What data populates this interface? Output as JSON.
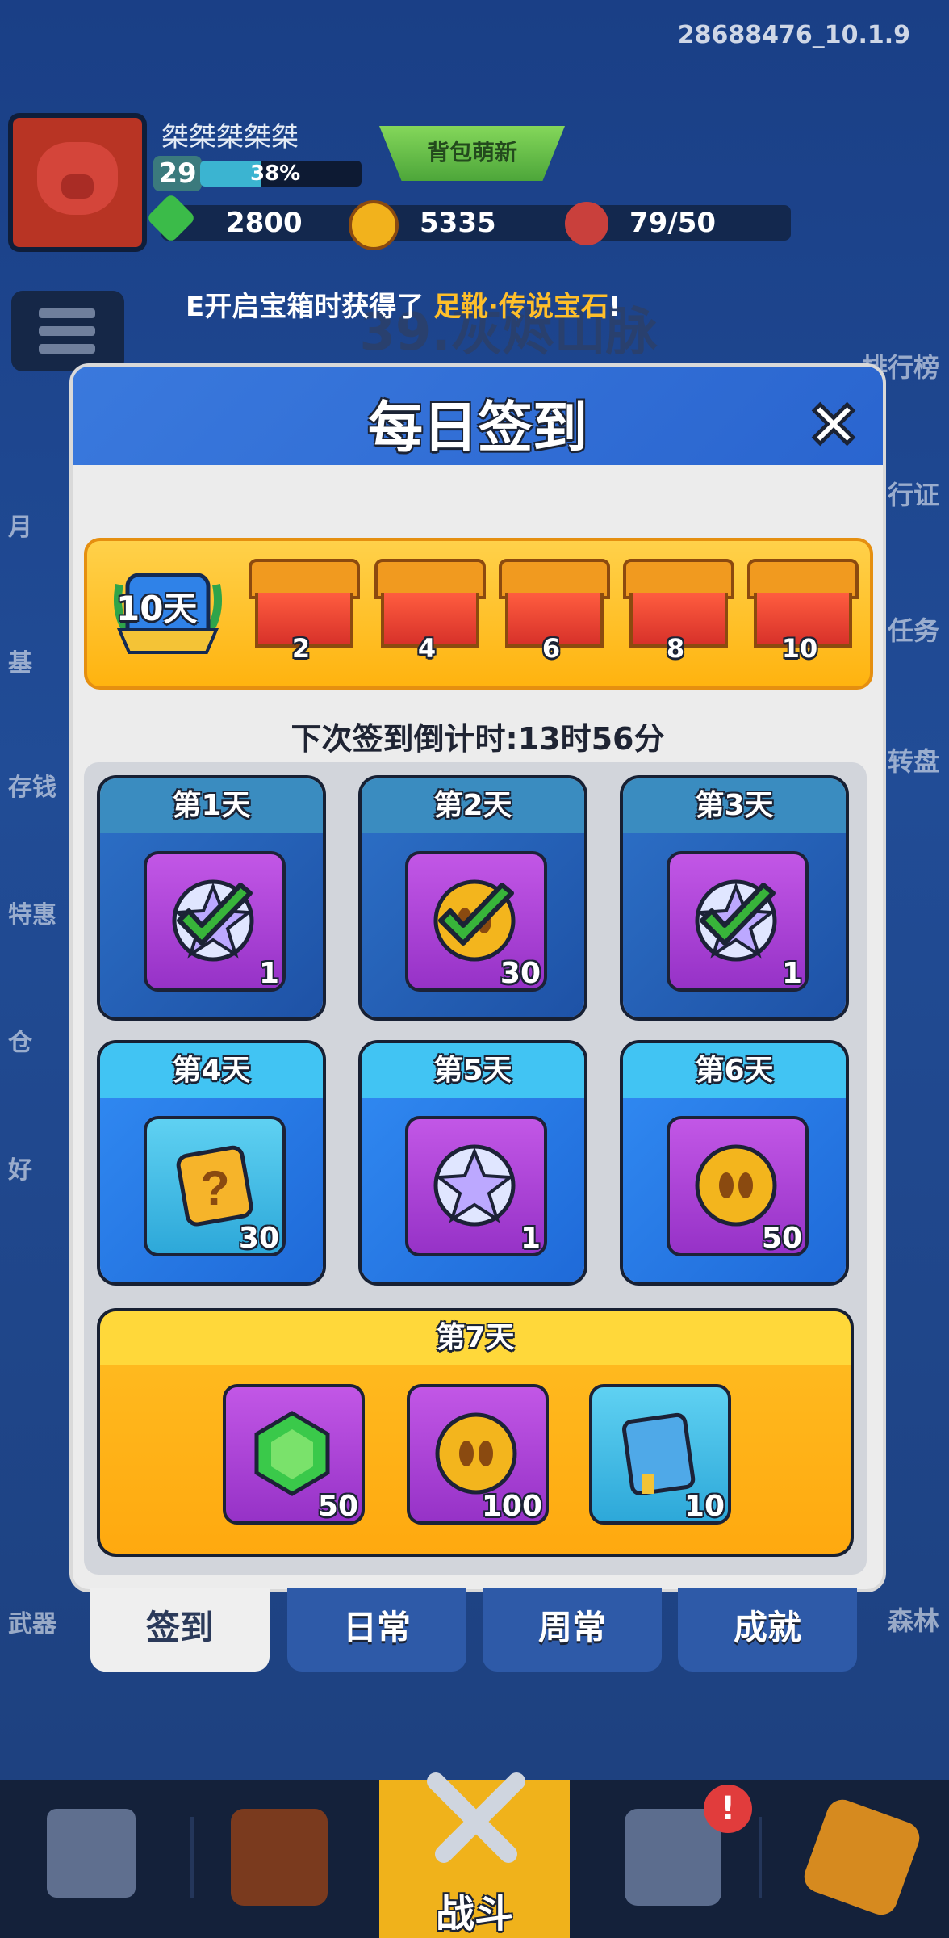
{
  "version": "28688476_10.1.9",
  "player": {
    "name": "桀桀桀桀桀",
    "level": "29",
    "xp_percent_label": "38%",
    "xp_fraction": 0.38
  },
  "resources": {
    "gems": "2800",
    "coins": "5335",
    "stamina": "79/50"
  },
  "news_tab": "背包萌新",
  "banner": {
    "prefix": "E开启宝箱时获得了 ",
    "highlight": "足靴·传说宝石",
    "suffix": "!"
  },
  "stage_title_bg": "39.灰烬山脉",
  "left_menu": [
    "月",
    "基",
    "存钱",
    "特惠",
    "仓",
    "好"
  ],
  "right_menu": [
    "排行榜",
    "行证",
    "任务",
    "转盘",
    "森林"
  ],
  "left_bottom_label": "武器",
  "modal": {
    "title": "每日签到",
    "streak_badge": "10天",
    "milestones": [
      "2",
      "4",
      "6",
      "8",
      "10"
    ],
    "countdown": "下次签到倒计时:13时56分",
    "days": [
      {
        "label": "第1天",
        "qty": "1",
        "icon": "star-gem-icon",
        "claimed": true
      },
      {
        "label": "第2天",
        "qty": "30",
        "icon": "coin-icon",
        "claimed": true
      },
      {
        "label": "第3天",
        "qty": "1",
        "icon": "star-gem-icon",
        "claimed": true
      },
      {
        "label": "第4天",
        "qty": "30",
        "icon": "mystery-box-icon",
        "claimed": false
      },
      {
        "label": "第5天",
        "qty": "1",
        "icon": "star-gem-icon",
        "claimed": false
      },
      {
        "label": "第6天",
        "qty": "50",
        "icon": "coin-icon",
        "claimed": false
      }
    ],
    "day7": {
      "label": "第7天",
      "items": [
        {
          "icon": "green-gem-icon",
          "qty": "50"
        },
        {
          "icon": "coin-icon",
          "qty": "100"
        },
        {
          "icon": "blue-book-icon",
          "qty": "10"
        }
      ]
    }
  },
  "tabs": [
    "签到",
    "日常",
    "周常",
    "成就"
  ],
  "bottom_nav": {
    "battle_label": "战斗"
  },
  "colors": {
    "accent": "#ffb30f",
    "modal_header": "#2a65cf",
    "claimed_check": "#38b43a"
  }
}
